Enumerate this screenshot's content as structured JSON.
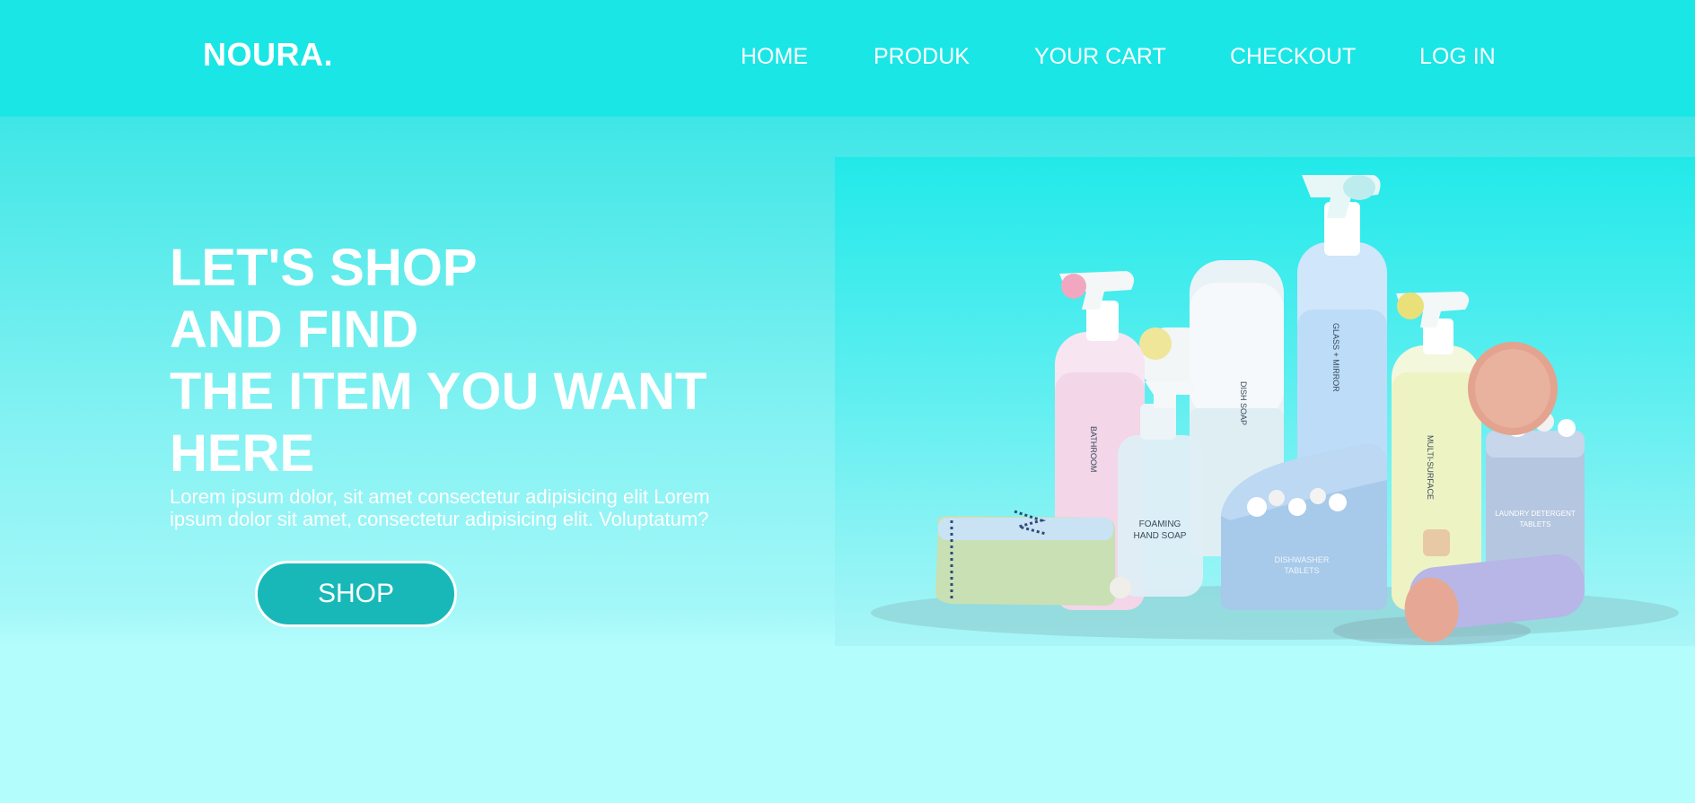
{
  "brand": {
    "logo": "NOURA."
  },
  "nav": {
    "items": [
      {
        "label": "HOME"
      },
      {
        "label": "PRODUK"
      },
      {
        "label": "YOUR CART"
      },
      {
        "label": "CHECKOUT"
      },
      {
        "label": "LOG IN"
      }
    ]
  },
  "hero": {
    "title_lines": [
      "LET'S SHOP",
      "AND FIND",
      "THE ITEM YOU WANT",
      "HERE"
    ],
    "description": "Lorem ipsum dolor, sit amet consectetur adipisicing elit Lorem ipsum dolor sit amet, consectetur adipisicing elit. Voluptatum?",
    "button_label": "SHOP"
  },
  "products": {
    "labels": {
      "bathroom": "BATHROOM",
      "dish_soap": "DISH SOAP",
      "glass": "GLASS + MIRROR",
      "multi": "MULTI-SURFACE",
      "foaming": "FOAMING",
      "hand_soap": "HAND SOAP",
      "dishwasher": "DISHWASHER",
      "tablets": "TABLETS",
      "laundry": "LAUNDRY DETERGENT",
      "laundry_tablets": "TABLETS"
    }
  },
  "colors": {
    "nav_bg": "#1ae6e6",
    "button_bg": "#18b8b8",
    "text": "#ffffff"
  }
}
